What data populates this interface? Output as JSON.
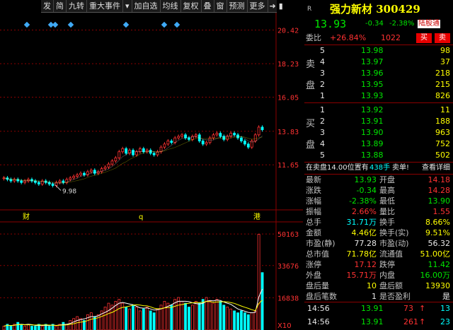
{
  "toolbar": {
    "items": [
      "发",
      "简",
      "九转",
      "重大事件",
      "▾",
      "加自选",
      "均线",
      "复权",
      "叠",
      "窗",
      "预测",
      "更多"
    ],
    "icons": [
      "pin-icon",
      "expand-icon"
    ]
  },
  "chart": {
    "price_labels": [
      "20.42",
      "18.23",
      "16.05",
      "13.83",
      "11.65"
    ],
    "volume_labels": [
      "50163",
      "33676",
      "16838"
    ],
    "volume_unit": "X10",
    "low_marker": "9.98",
    "event_markers": [
      "财",
      "q",
      "港"
    ]
  },
  "chart_data": {
    "type": "candlestick",
    "price_axis": [
      11.65,
      20.42
    ],
    "price_ticks": [
      20.42,
      18.23,
      16.05,
      13.83,
      11.65
    ],
    "volume_ticks": [
      50163,
      33676,
      16838
    ],
    "volume_unit": "X10",
    "low_marked": 9.98,
    "last_close": 13.93,
    "closes": [
      10.8,
      10.7,
      10.6,
      10.7,
      10.6,
      10.5,
      10.6,
      10.7,
      10.6,
      10.5,
      10.4,
      10.6,
      10.5,
      10.4,
      10.3,
      10.5,
      10.6,
      10.5,
      10.7,
      10.8,
      10.9,
      11.0,
      11.1,
      11.0,
      11.2,
      11.3,
      11.1,
      11.2,
      11.4,
      11.5,
      11.7,
      11.9,
      12.1,
      12.5,
      12.7,
      12.4,
      12.6,
      12.3,
      12.5,
      12.7,
      12.5,
      12.6,
      12.4,
      12.3,
      12.5,
      12.8,
      13.0,
      13.2,
      13.1,
      13.4,
      13.5,
      13.6,
      13.4,
      13.3,
      13.5,
      13.6,
      13.2,
      13.0,
      13.1,
      13.4,
      13.6,
      13.7,
      13.5,
      13.3,
      13.5,
      13.7,
      13.6,
      13.4,
      13.2,
      13.0,
      12.8,
      13.2,
      13.6,
      14.1,
      13.93
    ],
    "volumes": [
      2,
      3,
      2,
      3,
      4,
      3,
      2,
      3,
      2,
      2,
      3,
      2,
      3,
      2,
      3,
      2,
      3,
      4,
      3,
      5,
      6,
      7,
      6,
      5,
      8,
      9,
      7,
      8,
      10,
      12,
      14,
      13,
      15,
      16,
      14,
      12,
      11,
      13,
      12,
      10,
      11,
      12,
      10,
      9,
      11,
      13,
      15,
      14,
      13,
      16,
      17,
      15,
      14,
      12,
      13,
      15,
      14,
      16,
      17,
      15,
      14,
      16,
      15,
      13,
      12,
      11,
      10,
      9,
      10,
      9,
      8,
      9,
      10,
      50,
      30
    ],
    "volume_scale_note": "volumes in thousands (X10 units)"
  },
  "quote": {
    "name": "强力新材 300429",
    "price": "13.93",
    "change": "-0.34",
    "change_pct": "-2.38%",
    "tag": "陆股通",
    "r_mark": "R",
    "weibi_label": "委比",
    "weibi_pct": "+26.84%",
    "weicha": "1022",
    "buy_btn": "买",
    "sell_btn": "卖"
  },
  "sell_levels": [
    {
      "n": "5",
      "price": "13.98",
      "vol": "98"
    },
    {
      "n": "4",
      "price": "13.97",
      "vol": "37"
    },
    {
      "n": "3",
      "price": "13.96",
      "vol": "218"
    },
    {
      "n": "2",
      "price": "13.95",
      "vol": "215"
    },
    {
      "n": "1",
      "price": "13.93",
      "vol": "826"
    }
  ],
  "sell_labels": [
    "卖",
    "盘"
  ],
  "buy_levels": [
    {
      "n": "1",
      "price": "13.92",
      "vol": "11"
    },
    {
      "n": "2",
      "price": "13.91",
      "vol": "188"
    },
    {
      "n": "3",
      "price": "13.90",
      "vol": "963"
    },
    {
      "n": "4",
      "price": "13.89",
      "vol": "752"
    },
    {
      "n": "5",
      "price": "13.88",
      "vol": "502"
    }
  ],
  "buy_labels": [
    "买",
    "盘"
  ],
  "alert": {
    "text": "在卖盘14.00位置有",
    "amount": "438手",
    "tail": "卖单!",
    "detail": "查看详细"
  },
  "stats": [
    {
      "k1": "最新",
      "v1": "13.93",
      "k2": "开盘",
      "v2": "14.18"
    },
    {
      "k1": "涨跌",
      "v1": "-0.34",
      "k2": "最高",
      "v2": "14.28"
    },
    {
      "k1": "涨幅",
      "v1": "-2.38%",
      "k2": "最低",
      "v2": "13.90"
    },
    {
      "k1": "振幅",
      "v1": "2.66%",
      "k2": "量比",
      "v2": "1.55"
    },
    {
      "k1": "总手",
      "v1": "31.71万",
      "k2": "换手",
      "v2": "8.66%"
    },
    {
      "k1": "金额",
      "v1": "4.46亿",
      "k2": "换手(实)",
      "v2": "9.51%"
    },
    {
      "k1": "市盈(静)",
      "v1": "77.28",
      "k2": "市盈(动)",
      "v2": "56.32"
    },
    {
      "k1": "总市值",
      "v1": "71.78亿",
      "k2": "流通值",
      "v2": "51.00亿"
    },
    {
      "k1": "涨停",
      "v1": "17.12",
      "k2": "跌停",
      "v2": "11.42"
    },
    {
      "k1": "外盘",
      "v1": "15.71万",
      "k2": "内盘",
      "v2": "16.00万"
    },
    {
      "k1": "盘后量",
      "v1": "10",
      "k2": "盘后额",
      "v2": "13930"
    },
    {
      "k1": "盘后笔数",
      "v1": "1",
      "k2": "是否盈利",
      "v2": "是"
    }
  ],
  "ticks": [
    {
      "time": "14:56",
      "price": "13.91",
      "vol": "73",
      "arrow": "↑",
      "count": "13"
    },
    {
      "time": "14:56",
      "price": "13.91",
      "vol": "261",
      "arrow": "↑",
      "count": "23"
    }
  ],
  "colors": {
    "up": "#ff3232",
    "down": "#00e600",
    "volume_line": "#ffff00",
    "accent": "#00ffff"
  }
}
